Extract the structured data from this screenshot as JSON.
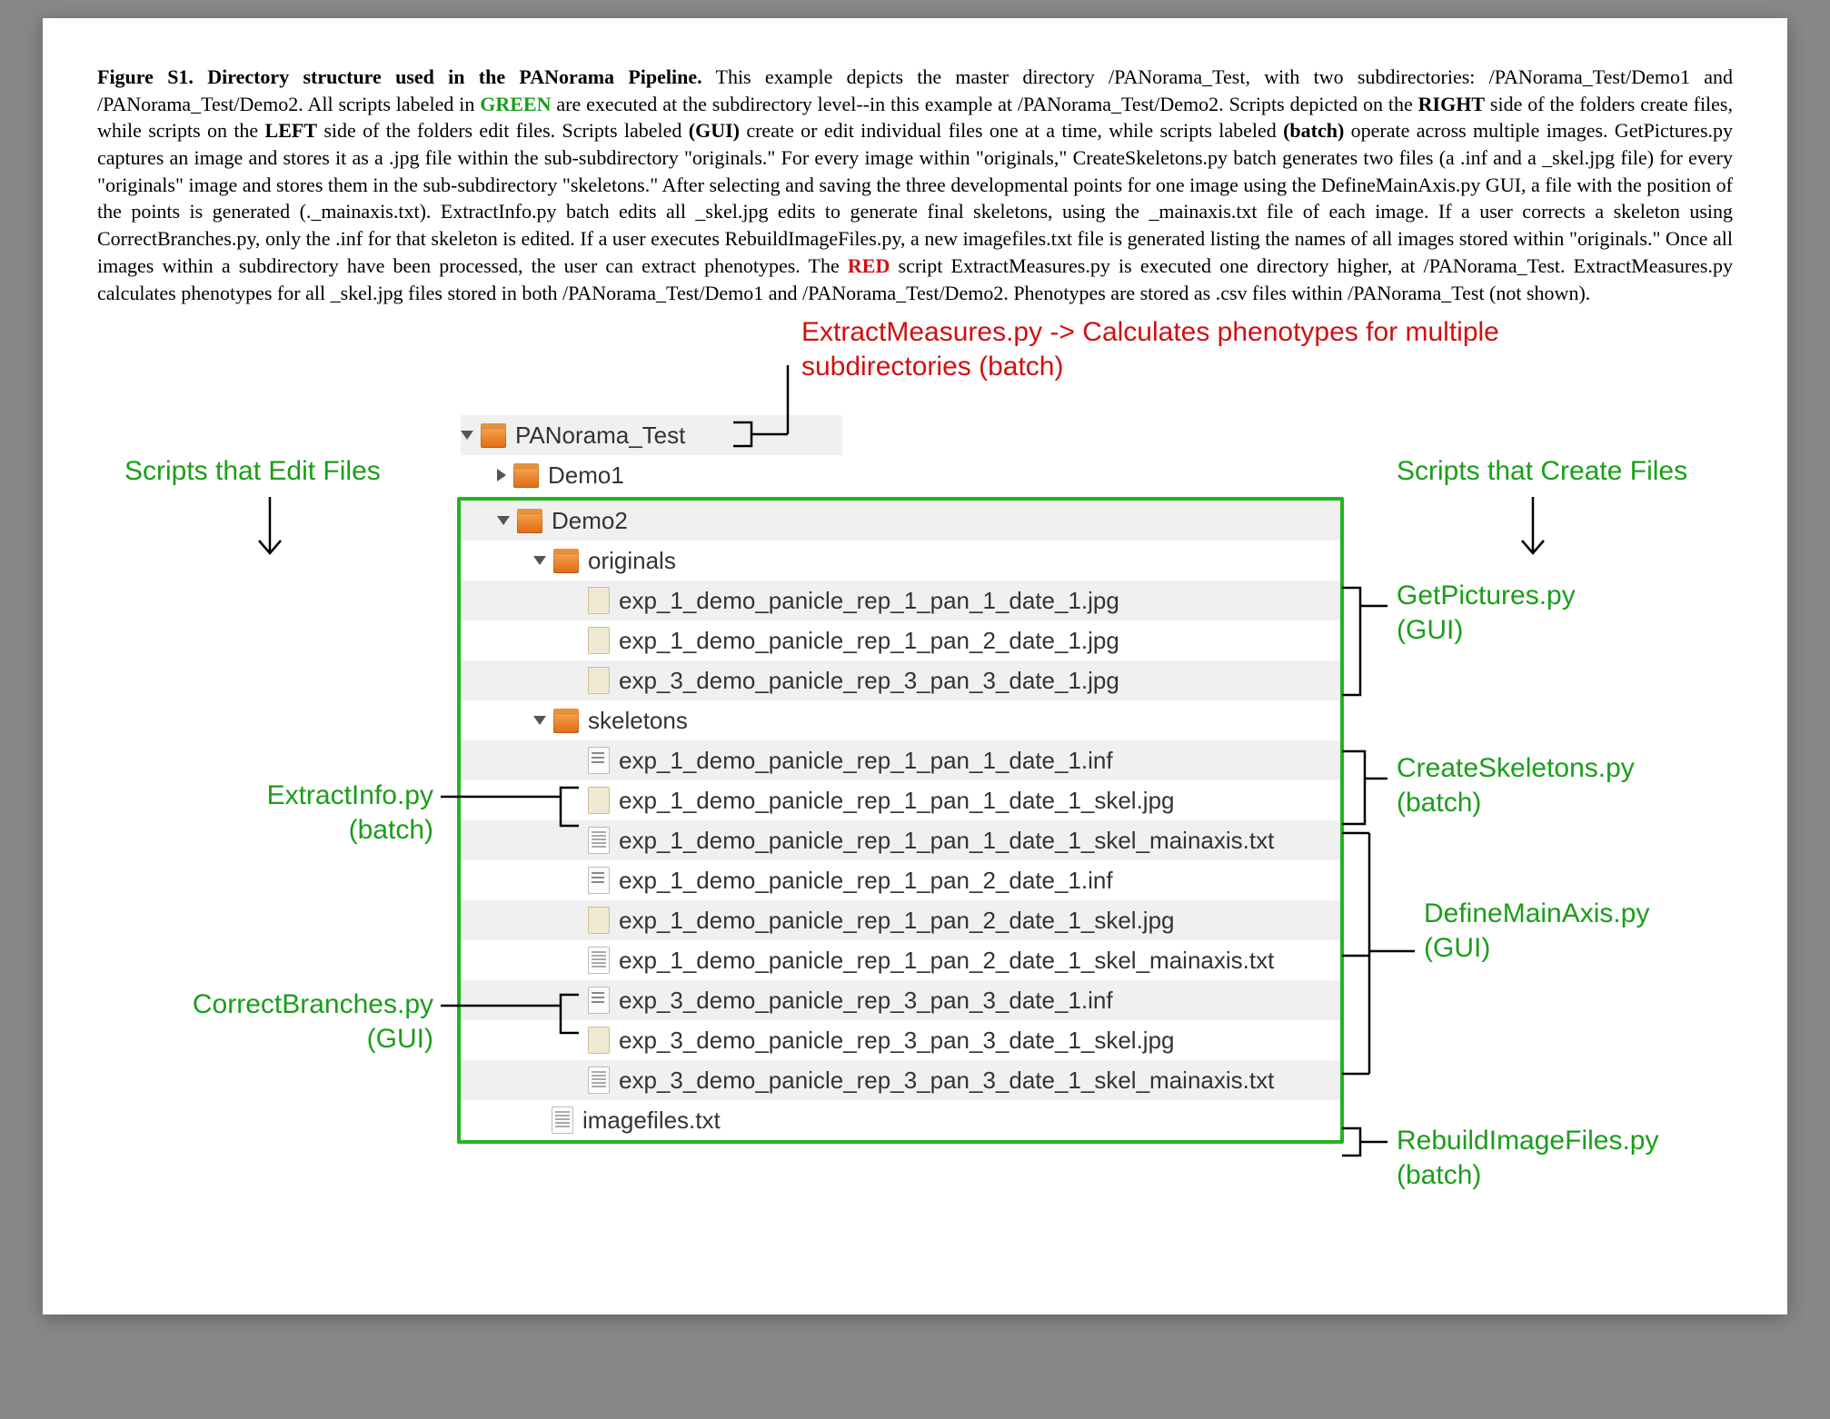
{
  "caption": {
    "figLabel": "Figure S1.  Directory structure used in the PANorama Pipeline.",
    "body1": " This example depicts the master directory /PANorama_Test, with two subdirectories: /PANorama_Test/Demo1 and /PANorama_Test/Demo2.  All scripts labeled in ",
    "greenWord": "GREEN",
    "body2": " are executed at the subdirectory level--in this example at /PANorama_Test/Demo2.  Scripts depicted on the ",
    "rightWord": "RIGHT",
    "body3": " side of the folders create files, while scripts on the ",
    "leftWord": "LEFT",
    "body4": " side of the folders edit files.  Scripts labeled ",
    "guiWord": "(GUI)",
    "body5": " create or edit individual files one at a time, while scripts labeled ",
    "batchWord": "(batch)",
    "body6": " operate across multiple images.   GetPictures.py captures an image and stores it as a .jpg file within the sub-subdirectory \"originals.\"  For every image within \"originals,\" CreateSkeletons.py batch generates two files (a .inf and a _skel.jpg file) for every \"originals\" image and stores them in the sub-subdirectory \"skeletons.\"  After selecting and saving the three developmental points for one image using the DefineMainAxis.py GUI, a file with the position of the points is generated (._mainaxis.txt).  ExtractInfo.py batch edits all _skel.jpg edits to generate final skeletons, using the _mainaxis.txt file of each image.  If a user corrects a skeleton using CorrectBranches.py, only the .inf for that skeleton is edited.  If a user executes RebuildImageFiles.py, a new imagefiles.txt file is generated listing the names of all images stored within \"originals.\"  Once all images within a subdirectory have been processed, the user can extract phenotypes.  The ",
    "redWord": "RED",
    "body7": " script ExtractMeasures.py is executed one directory higher, at /PANorama_Test.  ExtractMeasures.py calculates phenotypes for all _skel.jpg files stored in both /PANorama_Test/Demo1 and /PANorama_Test/Demo2.  Phenotypes are stored as .csv files within /PANorama_Test (not shown)."
  },
  "annotations": {
    "extractMeasures_l1": "ExtractMeasures.py -> Calculates phenotypes for multiple",
    "extractMeasures_l2": "subdirectories (batch)",
    "editHeader": "Scripts that Edit Files",
    "createHeader": "Scripts that Create Files",
    "getPictures_l1": "GetPictures.py",
    "getPictures_l2": "(GUI)",
    "createSkeletons_l1": "CreateSkeletons.py",
    "createSkeletons_l2": "(batch)",
    "defineMainAxis_l1": "DefineMainAxis.py",
    "defineMainAxis_l2": "(GUI)",
    "rebuildImageFiles_l1": "RebuildImageFiles.py",
    "rebuildImageFiles_l2": "(batch)",
    "extractInfo_l1": "ExtractInfo.py",
    "extractInfo_l2": "(batch)",
    "correctBranches_l1": "CorrectBranches.py",
    "correctBranches_l2": "(GUI)"
  },
  "tree": {
    "root": "PANorama_Test",
    "demo1": "Demo1",
    "demo2": "Demo2",
    "originals": "originals",
    "origFiles": [
      "exp_1_demo_panicle_rep_1_pan_1_date_1.jpg",
      "exp_1_demo_panicle_rep_1_pan_2_date_1.jpg",
      "exp_3_demo_panicle_rep_3_pan_3_date_1.jpg"
    ],
    "skeletons": "skeletons",
    "skelFiles": [
      "exp_1_demo_panicle_rep_1_pan_1_date_1.inf",
      "exp_1_demo_panicle_rep_1_pan_1_date_1_skel.jpg",
      "exp_1_demo_panicle_rep_1_pan_1_date_1_skel_mainaxis.txt",
      "exp_1_demo_panicle_rep_1_pan_2_date_1.inf",
      "exp_1_demo_panicle_rep_1_pan_2_date_1_skel.jpg",
      "exp_1_demo_panicle_rep_1_pan_2_date_1_skel_mainaxis.txt",
      "exp_3_demo_panicle_rep_3_pan_3_date_1.inf",
      "exp_3_demo_panicle_rep_3_pan_3_date_1_skel.jpg",
      "exp_3_demo_panicle_rep_3_pan_3_date_1_skel_mainaxis.txt"
    ],
    "imagefiles": "imagefiles.txt"
  }
}
